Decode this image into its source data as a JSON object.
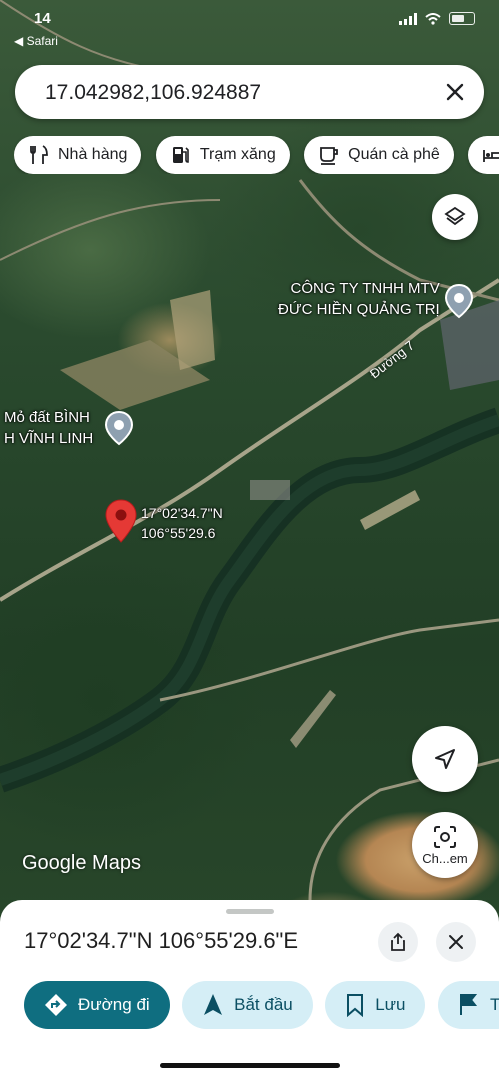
{
  "status": {
    "time": "14",
    "back_label": "◀ Safari"
  },
  "search": {
    "value": "17.042982,106.924887"
  },
  "chips": [
    {
      "label": "Nhà hàng",
      "icon": "restaurant-icon"
    },
    {
      "label": "Trạm xăng",
      "icon": "gas-station-icon"
    },
    {
      "label": "Quán cà phê",
      "icon": "coffee-icon"
    },
    {
      "label": "",
      "icon": "hotel-icon"
    }
  ],
  "map": {
    "place1": {
      "line1": "CÔNG TY TNHH MTV",
      "line2": "ĐỨC HIỀN QUẢNG TRỊ"
    },
    "place2": {
      "line1": "Mỏ đất BÌNH",
      "line2": "H VĨNH LINH"
    },
    "road": "Đường 7",
    "pin_lat": "17°02'34.7\"N",
    "pin_lng": "106°55'29.6",
    "watermark": "Google Maps",
    "lens_label": "Ch...em"
  },
  "sheet": {
    "title": "17°02'34.7\"N 106°55'29.6\"E",
    "actions": [
      {
        "label": "Đường đi",
        "icon": "directions-icon"
      },
      {
        "label": "Bắt đầu",
        "icon": "navigation-arrow-icon"
      },
      {
        "label": "Lưu",
        "icon": "bookmark-icon"
      },
      {
        "label": "T",
        "icon": "flag-icon"
      }
    ]
  },
  "colors": {
    "primary": "#0f6e80",
    "secondary": "#d5eef6",
    "pin": "#e53935"
  }
}
